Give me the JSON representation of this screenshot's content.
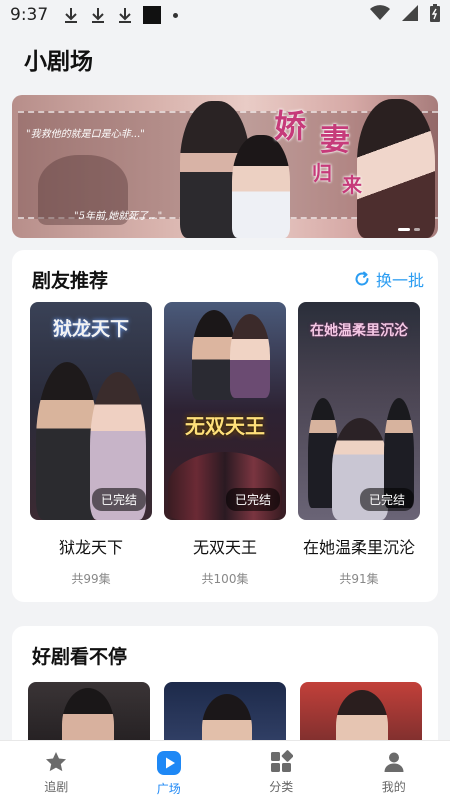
{
  "status_bar": {
    "time": "9:37"
  },
  "page": {
    "title": "小剧场"
  },
  "banner": {
    "title_chars": [
      "娇",
      "妻",
      "归",
      "来"
    ],
    "quote1": "\"我救他的就是口是心非...\"",
    "quote2": "\"5年前,她就死了...\"",
    "slide_count": 2,
    "active_slide": 1
  },
  "recommend": {
    "title": "剧友推荐",
    "refresh_label": "换一批",
    "items": [
      {
        "name": "狱龙天下",
        "count": "共99集",
        "badge": "已完结",
        "poster_text": "狱龙天下"
      },
      {
        "name": "无双天王",
        "count": "共100集",
        "badge": "已完结",
        "poster_text": "无双天王"
      },
      {
        "name": "在她温柔里沉沦",
        "count": "共91集",
        "badge": "已完结",
        "poster_text": "在她温柔里沉沦"
      }
    ]
  },
  "more": {
    "title": "好剧看不停"
  },
  "tabs": [
    {
      "label": "追剧",
      "icon": "star-icon"
    },
    {
      "label": "广场",
      "icon": "play-icon",
      "active": true
    },
    {
      "label": "分类",
      "icon": "grid-icon"
    },
    {
      "label": "我的",
      "icon": "user-icon"
    }
  ],
  "colors": {
    "accent": "#1e88f5",
    "refresh": "#2b9df2",
    "background": "#f2f3f5"
  }
}
